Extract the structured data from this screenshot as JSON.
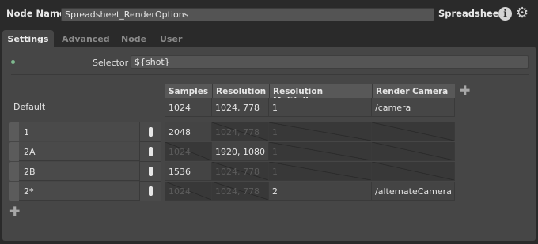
{
  "header": {
    "node_name_label": "Node Name",
    "node_name_value": "Spreadsheet_RenderOptions",
    "node_type": "Spreadsheet"
  },
  "tabs": [
    {
      "label": "Settings",
      "active": true
    },
    {
      "label": "Advanced",
      "active": false
    },
    {
      "label": "Node",
      "active": false
    },
    {
      "label": "User",
      "active": false
    }
  ],
  "selector": {
    "label": "Selector",
    "value": "${shot}"
  },
  "columns": [
    "Samples",
    "Resolution",
    "Resolution Multiplier",
    "Render Camera"
  ],
  "default_row": {
    "name": "Default",
    "cells": [
      "1024",
      "1024, 778",
      "1",
      "/camera"
    ]
  },
  "rows": [
    {
      "name": "1",
      "cells": [
        {
          "value": "2048",
          "active": true
        },
        {
          "value": "1024, 778",
          "active": false
        },
        {
          "value": "1",
          "active": false
        },
        {
          "value": "",
          "active": false
        }
      ]
    },
    {
      "name": "2A",
      "cells": [
        {
          "value": "1024",
          "active": false
        },
        {
          "value": "1920, 1080",
          "active": true
        },
        {
          "value": "1",
          "active": false
        },
        {
          "value": "",
          "active": false
        }
      ]
    },
    {
      "name": "2B",
      "cells": [
        {
          "value": "1536",
          "active": true
        },
        {
          "value": "1024, 778",
          "active": false
        },
        {
          "value": "1",
          "active": false
        },
        {
          "value": "",
          "active": false
        }
      ]
    },
    {
      "name": "2*",
      "cells": [
        {
          "value": "1024",
          "active": false
        },
        {
          "value": "1024, 778",
          "active": false
        },
        {
          "value": "2",
          "active": true
        },
        {
          "value": "/alternateCamera",
          "active": true
        }
      ]
    }
  ],
  "colors": {
    "background": "#2a2a2a",
    "panel": "#464646",
    "enabled_dot": "#7fb98f"
  },
  "icons": {
    "info": "info-icon",
    "settings": "gear-icon",
    "add": "plus-icon"
  }
}
